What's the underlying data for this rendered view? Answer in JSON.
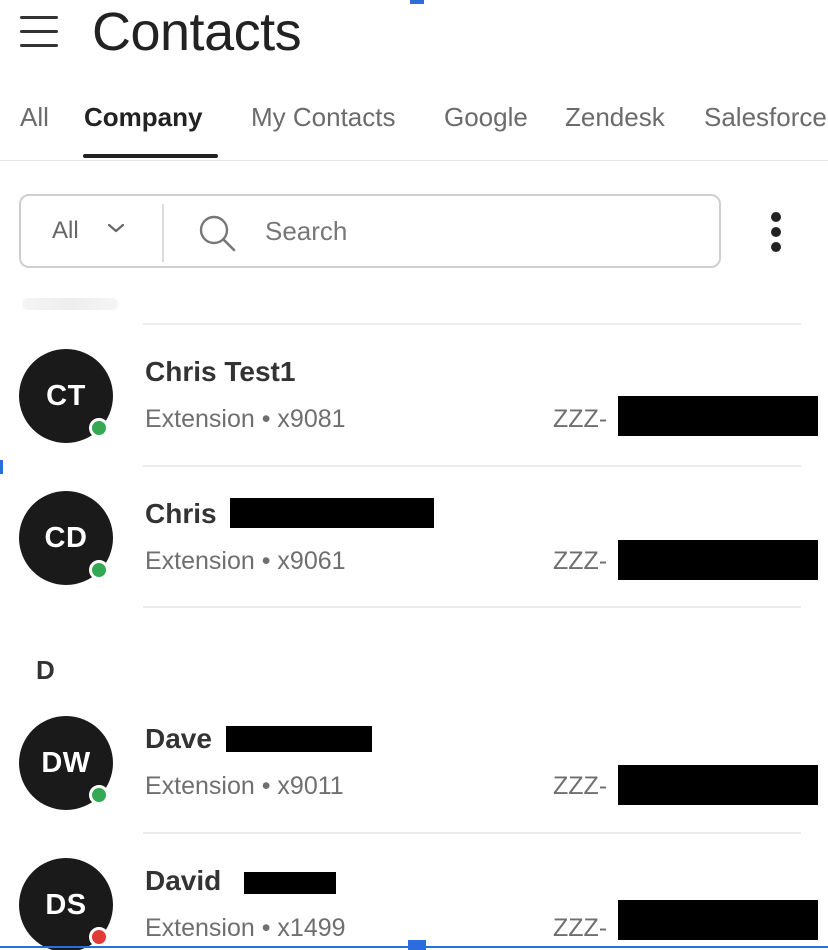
{
  "header": {
    "title": "Contacts"
  },
  "tabs": [
    {
      "label": "All",
      "active": false
    },
    {
      "label": "Company",
      "active": true
    },
    {
      "label": "My Contacts",
      "active": false
    },
    {
      "label": "Google",
      "active": false
    },
    {
      "label": "Zendesk",
      "active": false
    },
    {
      "label": "Salesforce",
      "active": false
    }
  ],
  "search": {
    "filter_value": "All",
    "placeholder": "Search",
    "value": ""
  },
  "contacts": [
    {
      "initials": "CT",
      "name": "Chris Test1",
      "subtitle": "Extension • x9081",
      "site": "ZZZ-",
      "presence": "available"
    },
    {
      "initials": "CD",
      "name": "Chris",
      "subtitle": "Extension • x9061",
      "site": "ZZZ-",
      "presence": "available"
    },
    {
      "initials": "DW",
      "name": "Dave",
      "subtitle": "Extension • x9011",
      "site": "ZZZ-",
      "presence": "available"
    },
    {
      "initials": "DS",
      "name": "David",
      "subtitle": "Extension • x1499",
      "site": "ZZZ-",
      "presence": "busy"
    }
  ],
  "sections": {
    "d_header": "D"
  },
  "colors": {
    "available": "#34a853",
    "busy": "#e53935",
    "avatar_bg": "#1a1a1a",
    "selection_accent": "#2d6cdf"
  }
}
